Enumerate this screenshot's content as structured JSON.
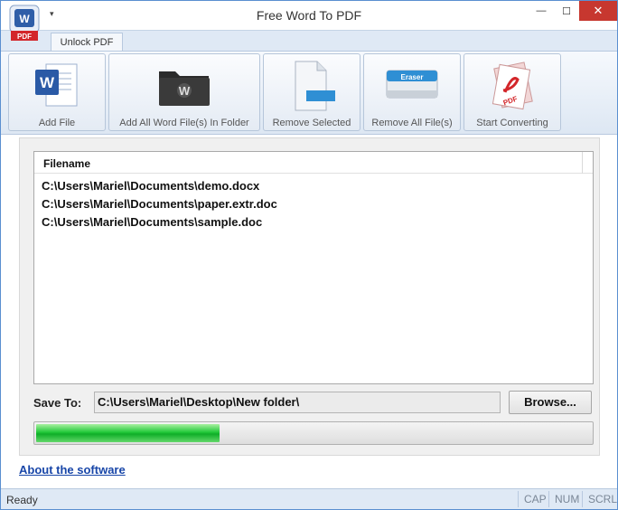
{
  "window": {
    "title": "Free Word To PDF",
    "icon_badge": "PDF",
    "controls": {
      "minimize": "—",
      "maximize": "☐",
      "close": "✕"
    }
  },
  "ribbon": {
    "tab_label": "Unlock PDF",
    "buttons": [
      {
        "label": "Add File",
        "icon": "word-document-icon"
      },
      {
        "label": "Add All Word File(s) In Folder",
        "icon": "folder-icon"
      },
      {
        "label": "Remove Selected",
        "icon": "remove-page-icon"
      },
      {
        "label": "Remove All File(s)",
        "icon": "eraser-icon"
      },
      {
        "label": "Start Converting",
        "icon": "pdf-convert-icon"
      }
    ],
    "eraser_text": "Eraser",
    "pdf_text": "PDF"
  },
  "filelist": {
    "column_header": "Filename",
    "rows": [
      "C:\\Users\\Mariel\\Documents\\demo.docx",
      "C:\\Users\\Mariel\\Documents\\paper.extr.doc",
      "C:\\Users\\Mariel\\Documents\\sample.doc"
    ]
  },
  "save": {
    "label": "Save To:",
    "path": "C:\\Users\\Mariel\\Desktop\\New folder\\",
    "browse_label": "Browse..."
  },
  "progress": {
    "value": 0.33,
    "color": "#22c93a"
  },
  "about_link": "About the software",
  "statusbar": {
    "status": "Ready",
    "cap": "CAP",
    "num": "NUM",
    "scrl": "SCRL"
  },
  "colors": {
    "accent": "#1846a8",
    "close_button": "#c7372f",
    "ribbon_bg": "#dfe9f5"
  }
}
